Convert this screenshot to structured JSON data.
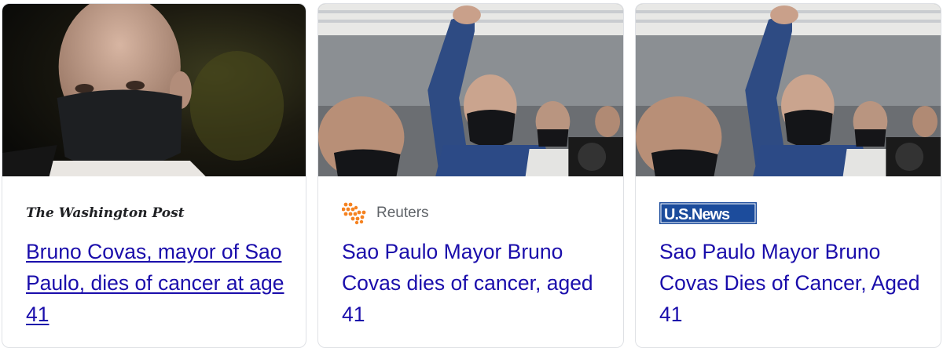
{
  "cards": [
    {
      "source": "The Washington Post",
      "headline": "Bruno Covas, mayor of Sao Paulo, dies of cancer at age 41",
      "underlined": true
    },
    {
      "source": "Reuters",
      "headline": "Sao Paulo Mayor Bruno Covas dies of cancer, aged 41",
      "underlined": false
    },
    {
      "source": "U.S.News",
      "headline": "Sao Paulo Mayor Bruno Covas Dies of Cancer, Aged 41",
      "underlined": false
    }
  ],
  "colors": {
    "headline_link": "#1a0dab",
    "source_text": "#5f6368",
    "card_border": "#dfe1e5",
    "reuters_orange": "#f58220",
    "usnews_blue": "#1c4c9c"
  },
  "icons": {
    "reuters": "reuters-dots-icon",
    "usnews": "usnews-logo"
  }
}
